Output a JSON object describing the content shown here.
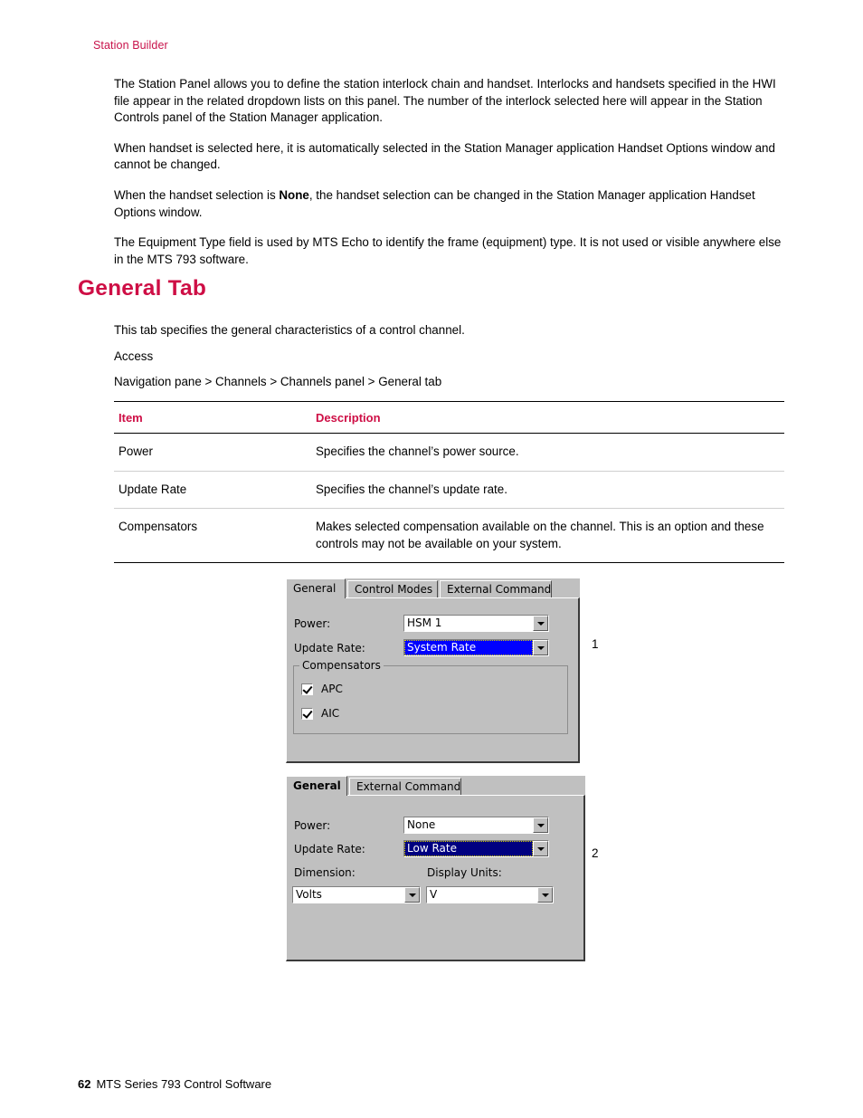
{
  "running_header": "Station Builder",
  "paragraphs": [
    "The Station Panel allows you to define the station interlock chain and handset. Interlocks and handsets specified in the HWI file appear in the related dropdown lists on this panel. The number of the interlock selected here will appear in the Station Controls panel of the Station Manager application.",
    "When handset is selected here, it is automatically selected in the Station Manager application Handset Options window and cannot be changed."
  ],
  "paragraph_none": {
    "before": "When the handset selection is ",
    "bold": "None",
    "after": ", the handset selection can be changed in the Station Manager application Handset Options window."
  },
  "paragraph_equipment": "The Equipment Type field is used by MTS Echo to identify the frame (equipment) type. It is not used or visible anywhere else in the MTS 793 software.",
  "section": {
    "heading": "General Tab",
    "intro": "This tab specifies the general characteristics of a control channel.",
    "access_label": "Access",
    "access_path": "Navigation pane > Channels > Channels panel > General tab"
  },
  "table": {
    "headers": [
      "Item",
      "Description"
    ],
    "rows": [
      {
        "item": "Power",
        "description": "Specifies the channel’s power source."
      },
      {
        "item": "Update Rate",
        "description": "Specifies the channel’s update rate."
      },
      {
        "item": "Compensators",
        "description": "Makes selected compensation available on the channel. This is an option and these controls may not be available on your system."
      }
    ]
  },
  "figure": {
    "callout_1": "1",
    "callout_2": "2",
    "dialog_1": {
      "tabs": [
        {
          "label": "General",
          "active": true
        },
        {
          "label": "Control Modes",
          "active": false
        },
        {
          "label": "External Command",
          "active": false
        }
      ],
      "power_label": "Power:",
      "power_value": "HSM 1",
      "update_rate_label": "Update Rate:",
      "update_rate_value": "System Rate",
      "compensators_title": "Compensators",
      "checkboxes": [
        {
          "label": "APC",
          "checked": true
        },
        {
          "label": "AIC",
          "checked": true
        }
      ]
    },
    "dialog_2": {
      "tabs": [
        {
          "label": "General",
          "active": true
        },
        {
          "label": "External Command",
          "active": false
        }
      ],
      "power_label": "Power:",
      "power_value": "None",
      "update_rate_label": "Update Rate:",
      "update_rate_value": "Low Rate",
      "dimension_label": "Dimension:",
      "dimension_value": "Volts",
      "display_units_label": "Display Units:",
      "display_units_value": "V"
    }
  },
  "footer": {
    "page_number": "62",
    "title": "MTS Series 793 Control Software"
  },
  "colors": {
    "accent": "#ce0e45",
    "header_accent": "#c8134b",
    "dialog_face": "#c0c0c0",
    "selection_bright": "#0000ff",
    "selection_navy": "#000080"
  }
}
